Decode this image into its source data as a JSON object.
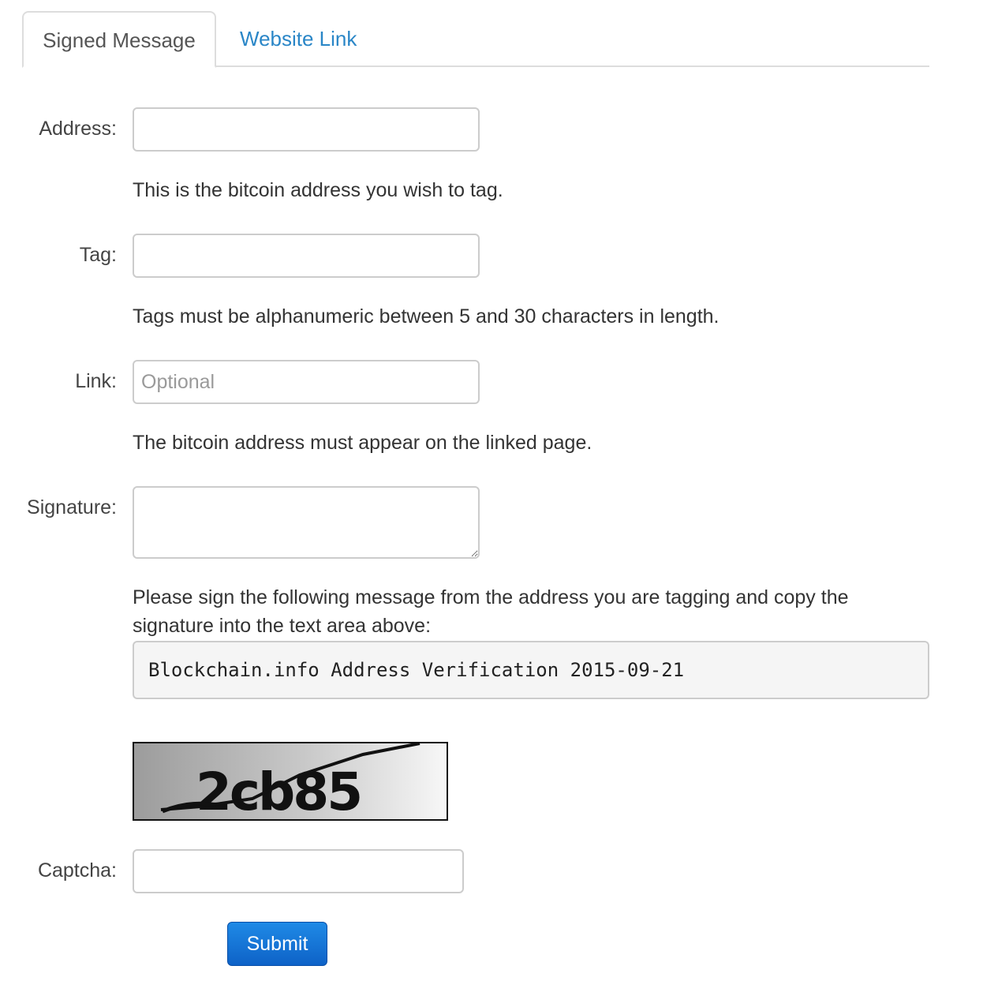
{
  "tabs": [
    {
      "label": "Signed Message",
      "active": true
    },
    {
      "label": "Website Link",
      "active": false
    }
  ],
  "form": {
    "address": {
      "label": "Address:",
      "value": "",
      "help": "This is the bitcoin address you wish to tag."
    },
    "tag": {
      "label": "Tag:",
      "value": "",
      "help": "Tags must be alphanumeric between 5 and 30 characters in length."
    },
    "link": {
      "label": "Link:",
      "value": "",
      "placeholder": "Optional",
      "help": "The bitcoin address must appear on the linked page."
    },
    "signature": {
      "label": "Signature:",
      "value": "",
      "help": "Please sign the following message from the address you are tagging and copy the signature into the text area above:",
      "message": "Blockchain.info Address Verification 2015-09-21"
    },
    "captcha": {
      "label": "Captcha:",
      "value": "",
      "image_text": "2cb85"
    },
    "submit_label": "Submit"
  },
  "colors": {
    "link": "#2a86c7",
    "button": "#1574d6",
    "border": "#cccccc"
  }
}
